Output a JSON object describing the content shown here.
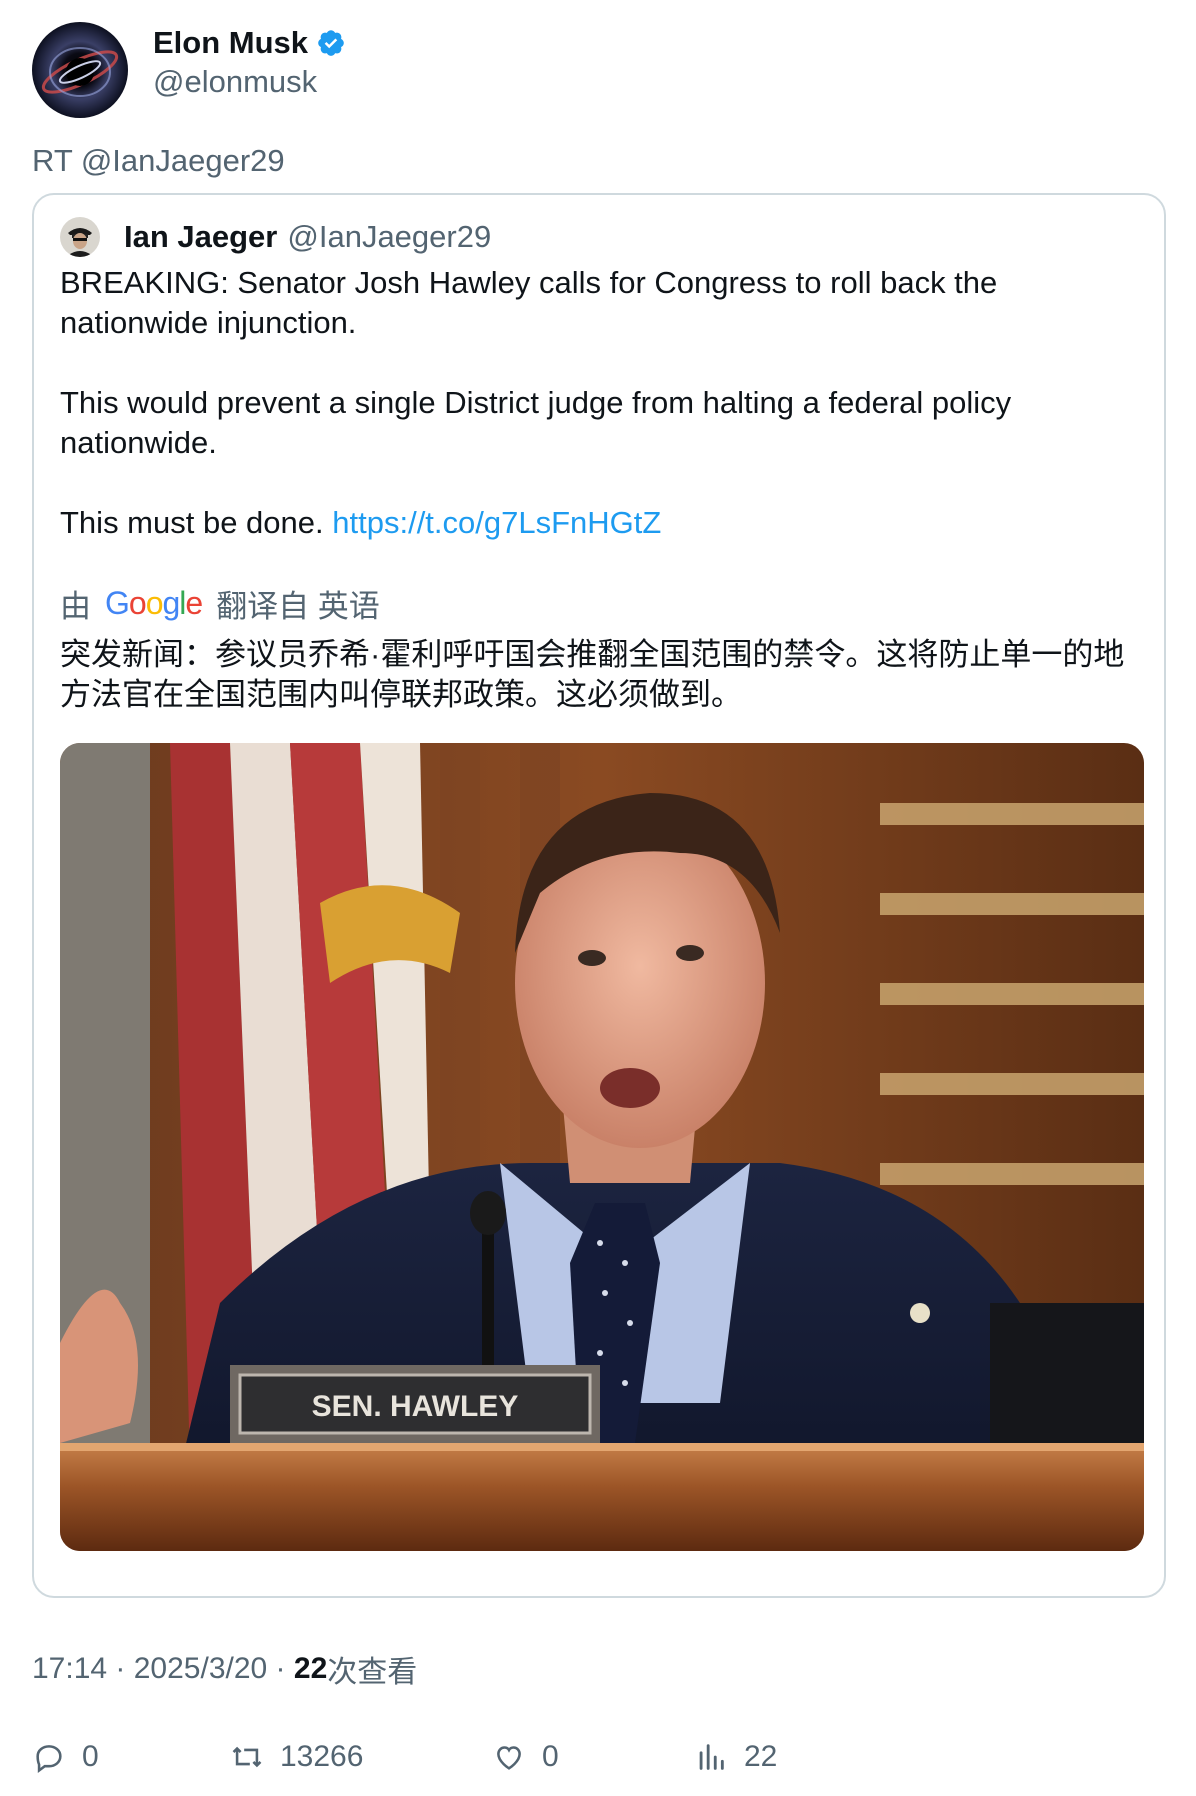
{
  "author": {
    "name": "Elon Musk",
    "handle": "@elonmusk",
    "verified": true
  },
  "retweet_label": "RT @IanJaeger29",
  "quoted": {
    "name": "Ian Jaeger",
    "handle": "@IanJaeger29",
    "paragraphs": [
      "BREAKING: Senator Josh Hawley calls for Congress to roll back the nationwide injunction.",
      "This would prevent a single District judge from halting a federal policy nationwide."
    ],
    "last_line": "This must be done.",
    "link": "https://t.co/g7LsFnHGtZ",
    "translation": {
      "prefix": "由",
      "brand": "Google",
      "suffix": "翻译自 英语",
      "text": "突发新闻：参议员乔希·霍利呼吁国会推翻全国范围的禁令。这将防止单一的地方法官在全国范围内叫停联邦政策。这必须做到。"
    },
    "image": {
      "nameplate": "SEN. HAWLEY"
    }
  },
  "meta": {
    "time": "17:14",
    "date": "2025/3/20",
    "views_count": "22",
    "views_label": "次查看"
  },
  "actions": {
    "replies": "0",
    "retweets": "13266",
    "likes": "0",
    "views": "22"
  },
  "colors": {
    "link": "#1d9bf0",
    "secondary_text": "#536471",
    "border": "#cfd9de",
    "verified": "#1d9bf0"
  }
}
